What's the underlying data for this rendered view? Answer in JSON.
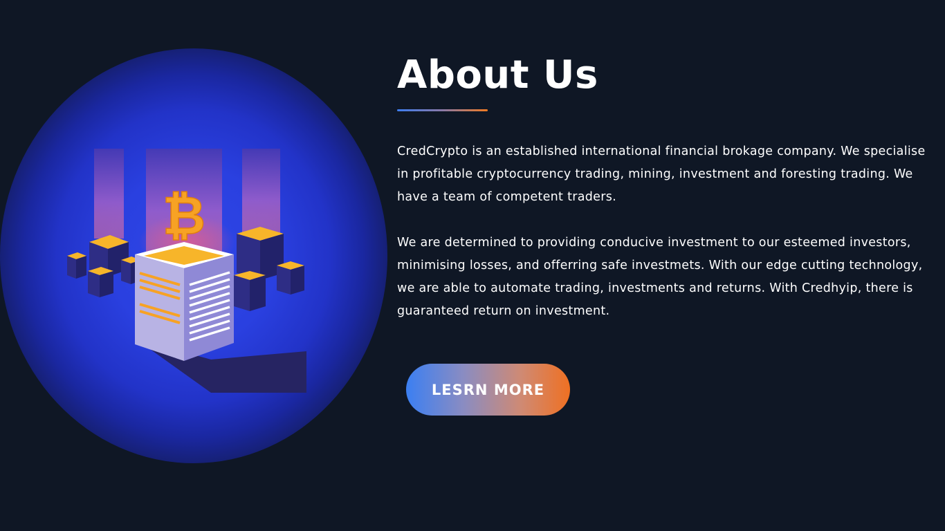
{
  "about": {
    "title": "About Us",
    "paragraphs": [
      "CredCrypto is an established international financial brokage company. We specialise in profitable cryptocurrency trading, mining, investment and foresting trading. We have a team of competent traders.",
      "We are determined to providing conducive investment to our esteemed investors, minimising losses, and offerring safe investmets. With our edge cutting technology, we are able to automate trading, investments and returns. With Credhyip, there is guaranteed return on investment."
    ],
    "cta_label": "LESRN MORE"
  },
  "illustration": {
    "symbol": "₿",
    "icon": "bitcoin-server-illustration"
  },
  "colors": {
    "background": "#0f1725",
    "glow": "#2f46e6",
    "accent_blue": "#3b7ff2",
    "accent_orange": "#ef7022",
    "bitcoin": "#f7a224"
  }
}
